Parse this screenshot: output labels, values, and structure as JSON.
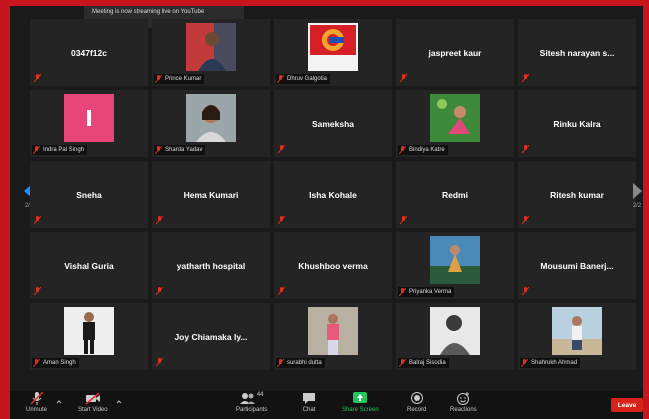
{
  "toast": {
    "text": "Meeting is now streaming live on YouTube"
  },
  "gallery": {
    "page_indicator": "2/2",
    "tiles": [
      {
        "name": "0347f12c",
        "label": "",
        "video": false
      },
      {
        "name": "Prince Kumar",
        "label": "Prince Kumar",
        "video": true
      },
      {
        "name": "Dhruv Galgotia",
        "label": "Dhruv Galgotia",
        "video": true
      },
      {
        "name": "jaspreet kaur",
        "label": "",
        "video": false
      },
      {
        "name": "Sitesh narayan s...",
        "label": "",
        "video": false
      },
      {
        "name": "Indra Pal Singh",
        "label": "Indra Pal Singh",
        "video": true
      },
      {
        "name": "Sharda Yadav",
        "label": "Sharda Yadav",
        "video": true
      },
      {
        "name": "Sameksha",
        "label": "",
        "video": false
      },
      {
        "name": "Bindiya Katre",
        "label": "Bindiya Katre",
        "video": true
      },
      {
        "name": "Rinku Kalra",
        "label": "",
        "video": false
      },
      {
        "name": "Sneha",
        "label": "",
        "video": false
      },
      {
        "name": "Hema Kumari",
        "label": "",
        "video": false
      },
      {
        "name": "Isha Kohale",
        "label": "",
        "video": false
      },
      {
        "name": "Redmi",
        "label": "",
        "video": false
      },
      {
        "name": "Ritesh kumar",
        "label": "",
        "video": false
      },
      {
        "name": "Vishal Guria",
        "label": "",
        "video": false
      },
      {
        "name": "yatharth hospital",
        "label": "",
        "video": false
      },
      {
        "name": "Khushboo verma",
        "label": "",
        "video": false
      },
      {
        "name": "Priyanka Verma",
        "label": "Priyanka Verma",
        "video": true
      },
      {
        "name": "Mousumi Banerj...",
        "label": "",
        "video": false
      },
      {
        "name": "Aman Singh",
        "label": "Aman Singh",
        "video": true
      },
      {
        "name": "Joy Chiamaka Iy...",
        "label": "",
        "video": false
      },
      {
        "name": "surabhi dutta",
        "label": "surabhi dutta",
        "video": true
      },
      {
        "name": "Balraj Sisodia",
        "label": "Balraj Sisodia",
        "video": true
      },
      {
        "name": "Shahrukh Ahmad",
        "label": "Shahrukh Ahmad",
        "video": true
      }
    ]
  },
  "toolbar": {
    "unmute": "Unmute",
    "start_video": "Start Video",
    "participants": "Participants",
    "participants_count": "44",
    "chat": "Chat",
    "share_screen": "Share Screen",
    "record": "Record",
    "reactions": "Reactions",
    "leave": "Leave"
  },
  "colors": {
    "accent_red": "#c8141c",
    "share_green": "#22c55e",
    "nav_blue": "#1e90ff",
    "muted_red": "#e0301e"
  }
}
